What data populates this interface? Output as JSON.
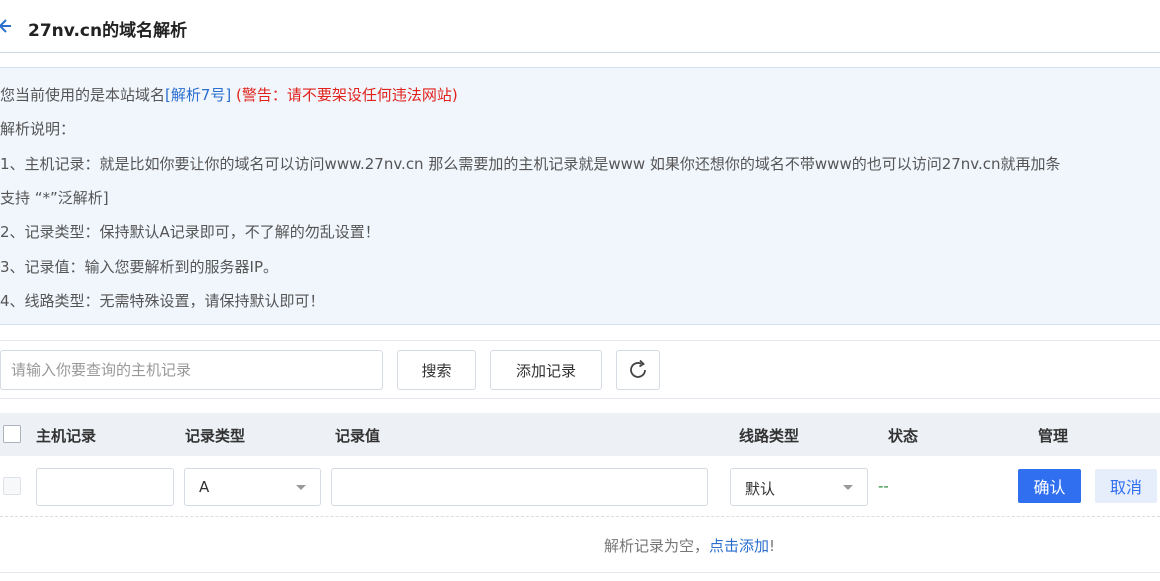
{
  "header": {
    "title": "27nv.cn的域名解析"
  },
  "notice": {
    "line1_prefix": "您当前使用的是本站域名",
    "line1_link": "[解析7号]",
    "line1_warning": "(警告：请不要架设任何违法网站)",
    "line2": "解析说明：",
    "line3": "1、主机记录：就是比如你要让你的域名可以访问www.27nv.cn 那么需要加的主机记录就是www 如果你还想你的域名不带www的也可以访问27nv.cn就再加条",
    "line4": "支持 “*”泛解析]",
    "line5": "2、记录类型：保持默认A记录即可，不了解的勿乱设置！",
    "line6": "3、记录值：输入您要解析到的服务器IP。",
    "line7": "4、线路类型：无需特殊设置，请保持默认即可！"
  },
  "toolbar": {
    "search_placeholder": "请输入你要查询的主机记录",
    "search_value": "",
    "search_button": "搜索",
    "add_button": "添加记录"
  },
  "table": {
    "headers": {
      "host": "主机记录",
      "type": "记录类型",
      "value": "记录值",
      "line": "线路类型",
      "status": "状态",
      "manage": "管理"
    },
    "edit_row": {
      "host_value": "",
      "type_selected": "A",
      "value_value": "",
      "line_selected": "默认",
      "status": "--",
      "confirm": "确认",
      "cancel": "取消"
    },
    "empty": {
      "text": "解析记录为空，",
      "link": "点击添加",
      "suffix": "!"
    }
  },
  "colors": {
    "primary": "#2f6ff0",
    "link": "#2a6fce",
    "warning": "#e0221b",
    "status": "#2a8a3a",
    "notice_bg": "#f1f6fd"
  }
}
